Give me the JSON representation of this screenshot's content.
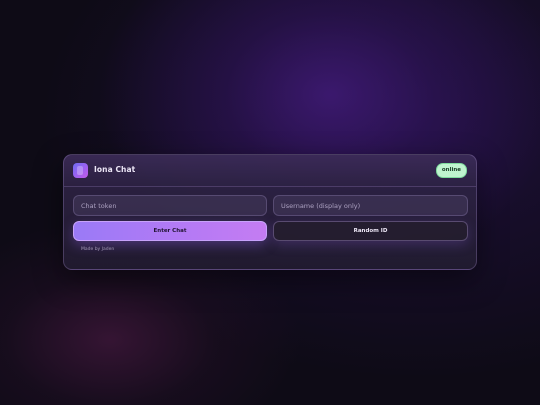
{
  "app": {
    "title": "Iona Chat",
    "status": "online"
  },
  "form": {
    "token_placeholder": "Chat token",
    "username_placeholder": "Username (display only)",
    "enter_label": "Enter Chat",
    "random_label": "Random ID"
  },
  "footer": {
    "credit": "Made by Jaden"
  },
  "icons": {
    "logo": "app-logo-icon"
  },
  "colors": {
    "accent": "#a97af5",
    "status_badge_bg": "#bff4cf",
    "background": "#0e0b16"
  }
}
